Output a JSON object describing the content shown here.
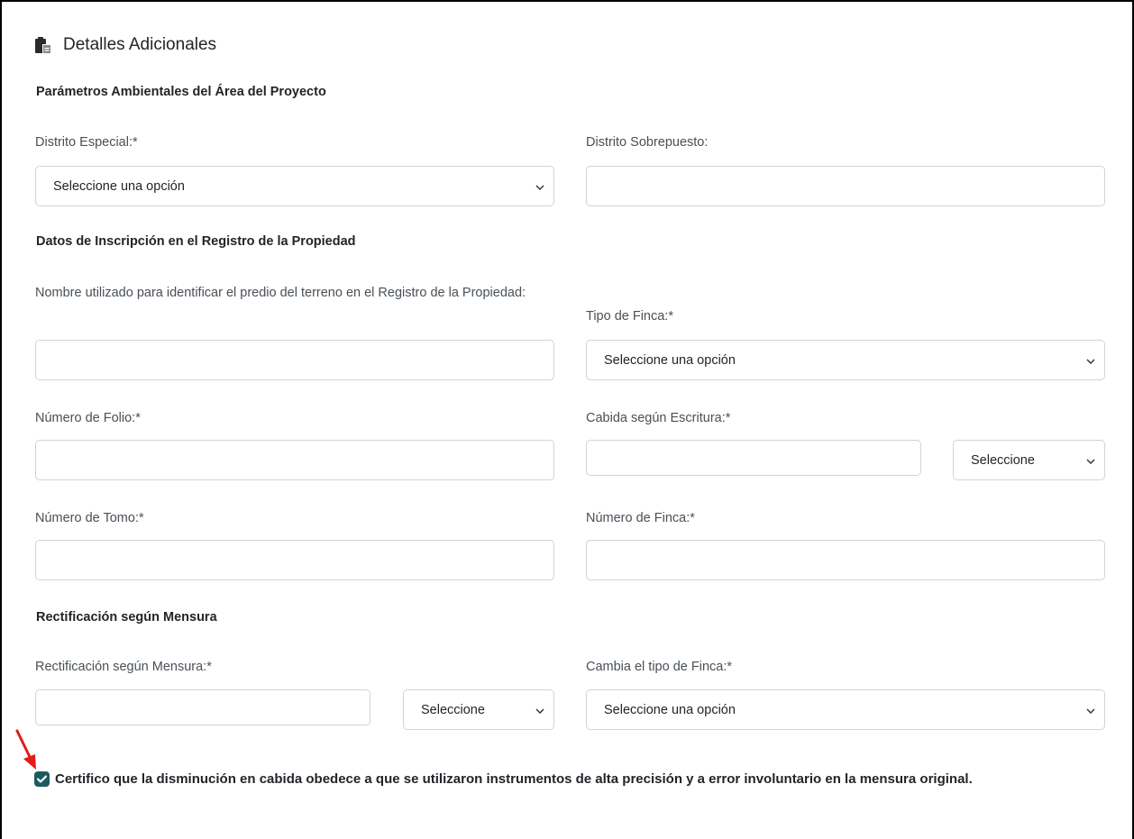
{
  "header": {
    "title": "Detalles Adicionales",
    "icon": "clipboard-icon"
  },
  "sections": {
    "ambientales": "Parámetros Ambientales del Área del Proyecto",
    "inscripcion": "Datos de Inscripción en el Registro de la Propiedad",
    "rectificacion": "Rectificación según Mensura"
  },
  "fields": {
    "distrito_especial": {
      "label": "Distrito Especial:*",
      "selected": "Seleccione una opción"
    },
    "distrito_sobrepuesto": {
      "label": "Distrito Sobrepuesto:",
      "value": ""
    },
    "nombre_predio": {
      "label": "Nombre utilizado para identificar el predio del terreno en el Registro de la Propiedad:",
      "value": ""
    },
    "tipo_finca": {
      "label": "Tipo de Finca:*",
      "selected": "Seleccione una opción"
    },
    "numero_folio": {
      "label": "Número de Folio:*",
      "value": ""
    },
    "cabida_escritura": {
      "label": "Cabida según Escritura:*",
      "value": "",
      "unit_selected": "Seleccione"
    },
    "numero_tomo": {
      "label": "Número de Tomo:*",
      "value": ""
    },
    "numero_finca": {
      "label": "Número de Finca:*",
      "value": ""
    },
    "rectificacion_mensura": {
      "label": "Rectificación según Mensura:*",
      "value": "",
      "unit_selected": "Seleccione"
    },
    "cambia_tipo_finca": {
      "label": "Cambia el tipo de Finca:*",
      "selected": "Seleccione una opción"
    }
  },
  "certificacion": {
    "checked": true,
    "text": "Certifico que la disminución en cabida obedece a que se utilizaron instrumentos de alta precisión y a error involuntario en la mensura original."
  },
  "colors": {
    "checkbox": "#1d5b61",
    "arrow": "#e31b1b",
    "border": "#ced4da"
  }
}
